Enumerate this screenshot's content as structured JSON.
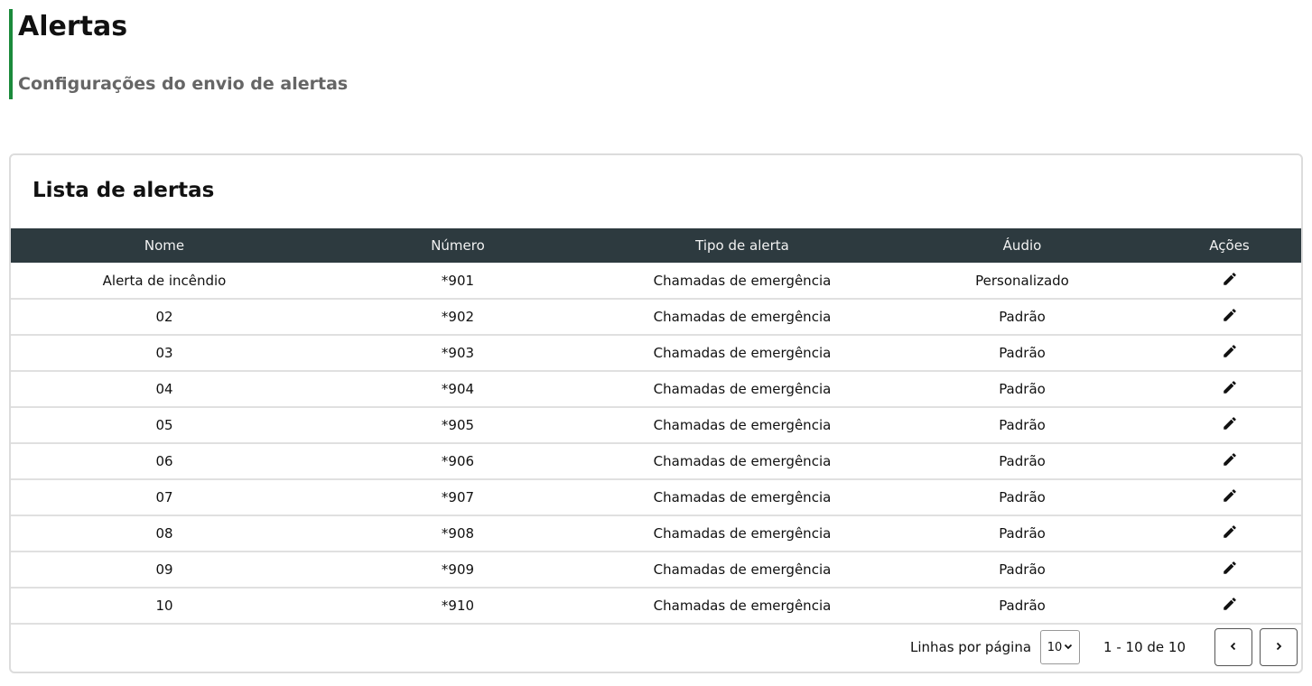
{
  "header": {
    "title": "Alertas",
    "subtitle": "Configurações do envio de alertas",
    "accent_color": "#1b8a3b"
  },
  "card": {
    "title": "Lista de alertas"
  },
  "table": {
    "header_bg": "#2d3a3f",
    "columns": [
      "Nome",
      "Número",
      "Tipo de alerta",
      "Áudio",
      "Ações"
    ],
    "rows": [
      {
        "nome": "Alerta de incêndio",
        "numero": "*901",
        "tipo": "Chamadas de emergência",
        "audio": "Personalizado",
        "action_icon": "pencil-icon"
      },
      {
        "nome": "02",
        "numero": "*902",
        "tipo": "Chamadas de emergência",
        "audio": "Padrão",
        "action_icon": "pencil-icon"
      },
      {
        "nome": "03",
        "numero": "*903",
        "tipo": "Chamadas de emergência",
        "audio": "Padrão",
        "action_icon": "pencil-icon"
      },
      {
        "nome": "04",
        "numero": "*904",
        "tipo": "Chamadas de emergência",
        "audio": "Padrão",
        "action_icon": "pencil-icon"
      },
      {
        "nome": "05",
        "numero": "*905",
        "tipo": "Chamadas de emergência",
        "audio": "Padrão",
        "action_icon": "pencil-icon"
      },
      {
        "nome": "06",
        "numero": "*906",
        "tipo": "Chamadas de emergência",
        "audio": "Padrão",
        "action_icon": "pencil-icon"
      },
      {
        "nome": "07",
        "numero": "*907",
        "tipo": "Chamadas de emergência",
        "audio": "Padrão",
        "action_icon": "pencil-icon"
      },
      {
        "nome": "08",
        "numero": "*908",
        "tipo": "Chamadas de emergência",
        "audio": "Padrão",
        "action_icon": "pencil-icon"
      },
      {
        "nome": "09",
        "numero": "*909",
        "tipo": "Chamadas de emergência",
        "audio": "Padrão",
        "action_icon": "pencil-icon"
      },
      {
        "nome": "10",
        "numero": "*910",
        "tipo": "Chamadas de emergência",
        "audio": "Padrão",
        "action_icon": "pencil-icon"
      }
    ]
  },
  "pagination": {
    "rows_label": "Linhas por página",
    "rows_per_page": "10",
    "range_text": "1 - 10 de 10",
    "prev_icon": "chevron-left-icon",
    "next_icon": "chevron-right-icon"
  }
}
